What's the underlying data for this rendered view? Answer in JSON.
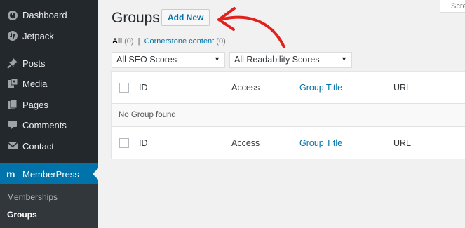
{
  "sidebar": {
    "items": [
      {
        "label": "Dashboard",
        "icon": "dashboard-icon"
      },
      {
        "label": "Jetpack",
        "icon": "jetpack-icon"
      },
      {
        "label": "Posts",
        "icon": "pin-icon"
      },
      {
        "label": "Media",
        "icon": "media-icon"
      },
      {
        "label": "Pages",
        "icon": "pages-icon"
      },
      {
        "label": "Comments",
        "icon": "comment-icon"
      },
      {
        "label": "Contact",
        "icon": "mail-icon"
      },
      {
        "label": "MemberPress",
        "icon": "memberpress-icon",
        "active": true
      }
    ],
    "submenu": [
      {
        "label": "Memberships"
      },
      {
        "label": "Groups",
        "current": true
      }
    ]
  },
  "header": {
    "title": "Groups",
    "add_new_label": "Add New",
    "screen_options_label": "Scre"
  },
  "filters": {
    "all_label": "All",
    "all_count": "(0)",
    "separator": "|",
    "cornerstone_label": "Cornerstone content",
    "cornerstone_count": "(0)",
    "seo_select": "All SEO Scores",
    "readability_select": "All Readability Scores"
  },
  "table": {
    "columns": [
      "ID",
      "Access",
      "Group Title",
      "URL"
    ],
    "empty_message": "No Group found"
  },
  "colors": {
    "sidebar_bg": "#23282d",
    "active_bg": "#0073aa",
    "link": "#0073aa",
    "annotation_arrow": "#e2211c"
  }
}
